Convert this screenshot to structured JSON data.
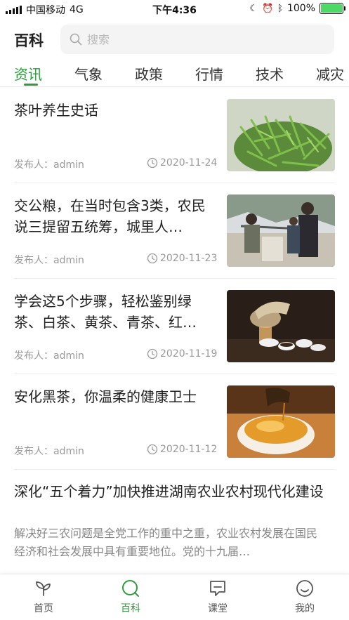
{
  "status_bar": {
    "carrier": "中国移动",
    "network": "4G",
    "time": "下午4:36",
    "battery_text": "100%",
    "battery_level": 1.0,
    "battery_color": "#4cd964"
  },
  "header": {
    "title": "百科",
    "search_placeholder": "搜索"
  },
  "tabs": [
    {
      "label": "资讯",
      "active": true
    },
    {
      "label": "气象",
      "active": false
    },
    {
      "label": "政策",
      "active": false
    },
    {
      "label": "行情",
      "active": false
    },
    {
      "label": "技术",
      "active": false
    },
    {
      "label": "减灾",
      "active": false
    }
  ],
  "accent_color": "#2e9b3e",
  "articles": [
    {
      "title": "茶叶养生史话",
      "author": "发布人：admin",
      "date": "2020-11-24",
      "image": "green-tea-leaves-photo"
    },
    {
      "title": "交公粮，在当时包含3类，农民说三提留五统筹，城里人…",
      "author": "发布人：admin",
      "date": "2020-11-23",
      "image": "farmers-weighing-grain-photo"
    },
    {
      "title": "学会这5个步骤，轻松鉴别绿茶、白茶、黄茶、青茶、红…",
      "author": "发布人：admin",
      "date": "2020-11-19",
      "image": "tea-pouring-photo"
    },
    {
      "title": "安化黑茶，你温柔的健康卫士",
      "author": "发布人：admin",
      "date": "2020-11-12",
      "image": "black-tea-cup-photo"
    }
  ],
  "feature_article": {
    "title": "深化“五个着力”加快推进湖南农业农村现代化建设",
    "summary": "解决好三农问题是全党工作的重中之重，农业农村发展在国民经济和社会发展中具有重要地位。党的十九届…"
  },
  "bottom_nav": [
    {
      "label": "首页",
      "icon": "sprout-icon",
      "active": false
    },
    {
      "label": "百科",
      "icon": "search-icon",
      "active": true
    },
    {
      "label": "课堂",
      "icon": "chat-icon",
      "active": false
    },
    {
      "label": "我的",
      "icon": "smile-icon",
      "active": false
    }
  ]
}
